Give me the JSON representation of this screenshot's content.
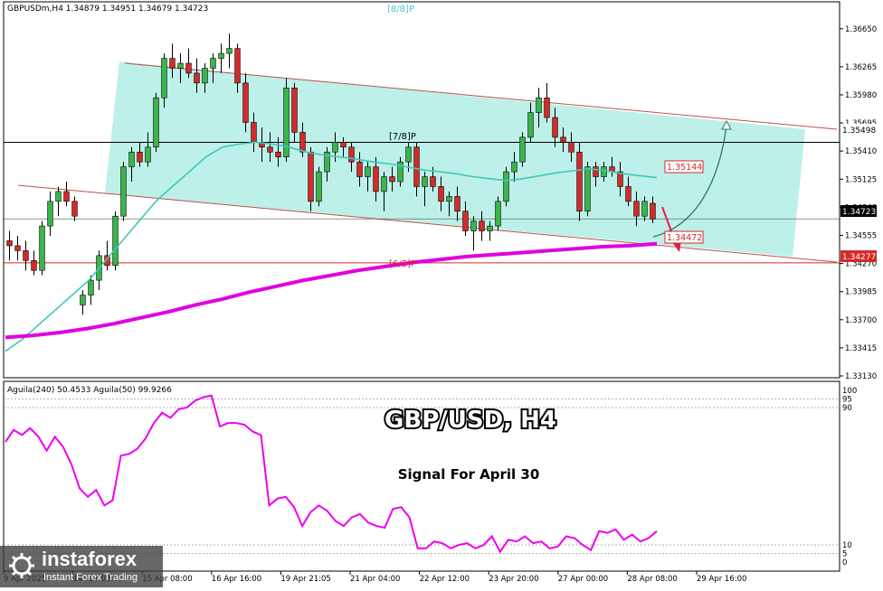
{
  "header": {
    "symbol_info": "GBPUSDm,H4  1.34879 1.34951 1.34679 1.34723",
    "indicator_info": "Aguila(240) 50.4533  Aguila(50) 99.9266"
  },
  "labels": {
    "murrey_8_8": "[8/8]P",
    "murrey_7_8": "[7/8]P",
    "murrey_6_8": "[6/8]P",
    "title": "GBP/USD, H4",
    "subtitle": "Signal For April 30"
  },
  "price_axis": {
    "ticks": [
      "1.36650",
      "1.36265",
      "1.35980",
      "1.35695",
      "1.35410",
      "1.35125",
      "1.34840",
      "1.34555",
      "1.34270",
      "1.33985",
      "1.33700",
      "1.33415",
      "1.33130"
    ],
    "range": [
      1.3313,
      1.3674
    ]
  },
  "price_markers": {
    "current": {
      "text": "1.34723",
      "value": 1.34723,
      "color": "#ffffff",
      "bg": "#000000"
    },
    "resistance": {
      "text": "1.35498",
      "value": 1.35498
    },
    "support": {
      "text": "1.34277",
      "value": 1.34277,
      "color": "#ffffff",
      "bg": "#d42a2a"
    },
    "ma_short": {
      "text": "1.35144",
      "value": 1.35144,
      "color": "#d42a2a"
    },
    "ma_long": {
      "text": "1.34472",
      "value": 1.34472,
      "color": "#d42a2a"
    }
  },
  "indicator_axis": {
    "ticks": [
      "100",
      "95",
      "90",
      "10",
      "5",
      "0"
    ],
    "range": [
      0,
      100
    ]
  },
  "time_axis": {
    "labels": [
      "9 Apr 2025",
      "14 Apr 00:00",
      "15 Apr 08:00",
      "16 Apr 16:00",
      "19 Apr 21:05",
      "21 Apr 04:00",
      "22 Apr 12:00",
      "23 Apr 20:00",
      "27 Apr 00:00",
      "28 Apr 08:00",
      "29 Apr 16:00"
    ]
  },
  "colors": {
    "channel_fill": "#bdf0e8",
    "channel_line": "#c0504d",
    "candle_up": "#39b54a",
    "candle_down": "#d42a2a",
    "ma_short": "#3fc9b6",
    "ma_long": "#e000e0",
    "indicator_line": "#ee00ee",
    "arrow_up": "#2e7d5b",
    "arrow_down": "#e02040"
  },
  "chart_data": {
    "type": "candlestick",
    "symbol": "GBPUSDm",
    "timeframe": "H4",
    "ohlc": [
      [
        1.345,
        1.346,
        1.343,
        1.3445
      ],
      [
        1.3445,
        1.3455,
        1.343,
        1.344
      ],
      [
        1.344,
        1.345,
        1.342,
        1.343
      ],
      [
        1.343,
        1.344,
        1.3415,
        1.342
      ],
      [
        1.342,
        1.347,
        1.3415,
        1.3465
      ],
      [
        1.3465,
        1.35,
        1.3455,
        1.349
      ],
      [
        1.349,
        1.3505,
        1.3475,
        1.35
      ],
      [
        1.35,
        1.351,
        1.3485,
        1.349
      ],
      [
        1.349,
        1.3495,
        1.347,
        1.3475
      ],
      [
        1.3385,
        1.34,
        1.3375,
        1.3395
      ],
      [
        1.3395,
        1.3415,
        1.3385,
        1.341
      ],
      [
        1.341,
        1.344,
        1.34,
        1.3435
      ],
      [
        1.3435,
        1.345,
        1.342,
        1.3425
      ],
      [
        1.3425,
        1.348,
        1.342,
        1.3475
      ],
      [
        1.3475,
        1.353,
        1.347,
        1.3525
      ],
      [
        1.3525,
        1.3545,
        1.351,
        1.354
      ],
      [
        1.354,
        1.355,
        1.3525,
        1.353
      ],
      [
        1.353,
        1.356,
        1.3525,
        1.3545
      ],
      [
        1.3545,
        1.36,
        1.354,
        1.3595
      ],
      [
        1.3595,
        1.364,
        1.3585,
        1.3635
      ],
      [
        1.3635,
        1.365,
        1.3615,
        1.3625
      ],
      [
        1.3625,
        1.364,
        1.361,
        1.363
      ],
      [
        1.363,
        1.3645,
        1.3615,
        1.362
      ],
      [
        1.362,
        1.3635,
        1.36,
        1.361
      ],
      [
        1.361,
        1.363,
        1.36,
        1.3625
      ],
      [
        1.3625,
        1.364,
        1.361,
        1.3635
      ],
      [
        1.3635,
        1.365,
        1.362,
        1.364
      ],
      [
        1.364,
        1.366,
        1.3625,
        1.3645
      ],
      [
        1.3645,
        1.365,
        1.36,
        1.361
      ],
      [
        1.361,
        1.362,
        1.356,
        1.357
      ],
      [
        1.357,
        1.358,
        1.354,
        1.355
      ],
      [
        1.355,
        1.3565,
        1.353,
        1.3545
      ],
      [
        1.3545,
        1.356,
        1.353,
        1.354
      ],
      [
        1.354,
        1.3555,
        1.3525,
        1.3535
      ],
      [
        1.3535,
        1.3615,
        1.353,
        1.3605
      ],
      [
        1.3605,
        1.361,
        1.355,
        1.356
      ],
      [
        1.356,
        1.357,
        1.3535,
        1.354
      ],
      [
        1.354,
        1.3545,
        1.348,
        1.349
      ],
      [
        1.349,
        1.3525,
        1.3485,
        1.352
      ],
      [
        1.352,
        1.3545,
        1.351,
        1.354
      ],
      [
        1.354,
        1.356,
        1.353,
        1.355
      ],
      [
        1.355,
        1.3555,
        1.3535,
        1.3545
      ],
      [
        1.3545,
        1.355,
        1.352,
        1.353
      ],
      [
        1.353,
        1.354,
        1.3505,
        1.3515
      ],
      [
        1.3515,
        1.353,
        1.35,
        1.3525
      ],
      [
        1.3525,
        1.3535,
        1.349,
        1.35
      ],
      [
        1.35,
        1.352,
        1.348,
        1.3515
      ],
      [
        1.3515,
        1.3525,
        1.35,
        1.351
      ],
      [
        1.351,
        1.3535,
        1.3505,
        1.353
      ],
      [
        1.353,
        1.355,
        1.352,
        1.3545
      ],
      [
        1.3545,
        1.355,
        1.3495,
        1.3505
      ],
      [
        1.3505,
        1.352,
        1.3485,
        1.3515
      ],
      [
        1.3515,
        1.3525,
        1.35,
        1.3505
      ],
      [
        1.3505,
        1.3515,
        1.348,
        1.349
      ],
      [
        1.349,
        1.35,
        1.3475,
        1.3495
      ],
      [
        1.3495,
        1.3505,
        1.347,
        1.348
      ],
      [
        1.348,
        1.349,
        1.3455,
        1.346
      ],
      [
        1.346,
        1.3475,
        1.344,
        1.347
      ],
      [
        1.347,
        1.348,
        1.345,
        1.346
      ],
      [
        1.346,
        1.347,
        1.345,
        1.3465
      ],
      [
        1.3465,
        1.3495,
        1.346,
        1.349
      ],
      [
        1.349,
        1.3525,
        1.3485,
        1.352
      ],
      [
        1.352,
        1.354,
        1.351,
        1.353
      ],
      [
        1.353,
        1.356,
        1.3525,
        1.3555
      ],
      [
        1.3555,
        1.359,
        1.355,
        1.358
      ],
      [
        1.358,
        1.3605,
        1.3565,
        1.3595
      ],
      [
        1.3595,
        1.361,
        1.357,
        1.3575
      ],
      [
        1.3575,
        1.3585,
        1.3545,
        1.3555
      ],
      [
        1.3555,
        1.3565,
        1.354,
        1.355
      ],
      [
        1.355,
        1.356,
        1.353,
        1.354
      ],
      [
        1.354,
        1.355,
        1.347,
        1.348
      ],
      [
        1.348,
        1.353,
        1.3475,
        1.3525
      ],
      [
        1.3525,
        1.353,
        1.3505,
        1.3515
      ],
      [
        1.3515,
        1.353,
        1.351,
        1.3525
      ],
      [
        1.3525,
        1.3535,
        1.3515,
        1.352
      ],
      [
        1.352,
        1.353,
        1.3495,
        1.3505
      ],
      [
        1.3505,
        1.3515,
        1.3485,
        1.349
      ],
      [
        1.349,
        1.35,
        1.3465,
        1.3475
      ],
      [
        1.3475,
        1.3495,
        1.347,
        1.349
      ],
      [
        1.3488,
        1.3495,
        1.3468,
        1.3472
      ]
    ],
    "ma_short": [
      1.3338,
      1.335,
      1.3365,
      1.338,
      1.3395,
      1.341,
      1.343,
      1.345,
      1.347,
      1.349,
      1.3505,
      1.352,
      1.3535,
      1.3545,
      1.3548,
      1.355,
      1.3548,
      1.3545,
      1.354,
      1.3537,
      1.3535,
      1.3533,
      1.353,
      1.3528,
      1.3525,
      1.3522,
      1.352,
      1.3518,
      1.3515,
      1.3513,
      1.3511,
      1.3513,
      1.3516,
      1.3519,
      1.3521,
      1.3523,
      1.3521,
      1.3518,
      1.3516,
      1.3514
    ],
    "ma_long": [
      1.3352,
      1.3354,
      1.3357,
      1.3361,
      1.3366,
      1.3372,
      1.3378,
      1.3385,
      1.3391,
      1.3398,
      1.3404,
      1.341,
      1.3415,
      1.342,
      1.3424,
      1.3428,
      1.3431,
      1.3434,
      1.3436,
      1.3438,
      1.344,
      1.3442,
      1.3444,
      1.3445,
      1.3447
    ],
    "indicator": {
      "name": "Aguila",
      "series": [
        {
          "name": "Aguila(240)",
          "values": [
            70,
            77,
            74,
            78,
            73,
            65,
            73,
            67,
            57,
            43,
            38,
            42,
            33,
            36,
            62,
            63,
            66,
            72,
            81,
            87,
            84,
            89,
            90,
            94,
            96,
            97,
            79,
            81,
            81,
            80,
            76,
            74,
            33,
            37,
            38,
            32,
            21,
            29,
            33,
            30,
            24,
            21,
            26,
            28,
            23,
            21,
            20,
            31,
            32,
            26,
            8,
            8,
            12,
            11,
            8,
            10,
            11,
            8,
            10,
            15,
            6,
            13,
            12,
            15,
            11,
            12,
            8,
            9,
            15,
            14,
            10,
            7,
            18,
            17,
            19,
            13,
            16,
            12,
            14,
            18
          ]
        }
      ]
    }
  }
}
